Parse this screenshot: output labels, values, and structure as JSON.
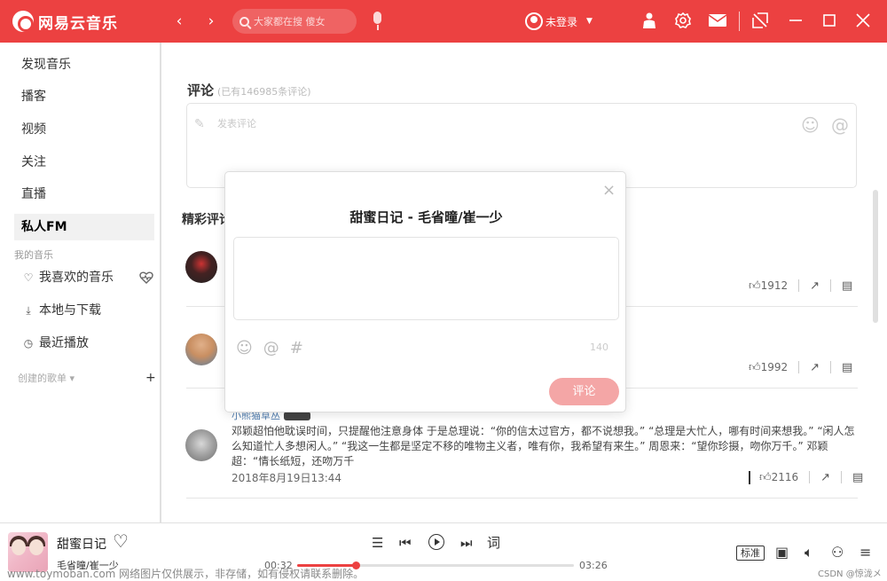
{
  "app": {
    "logo_text": "网易云音乐"
  },
  "header": {
    "back_glyph": "‹",
    "forward_glyph": "›",
    "search_placeholder": "大家都在搜 傻女",
    "user_label": "未登录",
    "icons": [
      "back-icon",
      "forward-icon",
      "search-icon",
      "mic-icon",
      "avatar",
      "clothes-icon",
      "gear-icon",
      "mail-icon",
      "mini-mode-icon",
      "minimize-icon",
      "maximize-icon",
      "close-icon"
    ]
  },
  "sidebar": {
    "items": [
      {
        "label": "发现音乐"
      },
      {
        "label": "播客"
      },
      {
        "label": "视频"
      },
      {
        "label": "关注"
      },
      {
        "label": "直播"
      },
      {
        "label": "私人FM"
      }
    ],
    "my_music_title": "我的音乐",
    "my_music": [
      {
        "label": "我喜欢的音乐",
        "icon": "heart-icon"
      },
      {
        "label": "本地与下载",
        "icon": "download-icon"
      },
      {
        "label": "最近播放",
        "icon": "clock-icon"
      }
    ],
    "created_playlists": "创建的歌单",
    "add_glyph": "+"
  },
  "comments": {
    "title": "评论",
    "count_text": "(已有146985条评论)",
    "input_placeholder": "发表评论",
    "hot_title": "精彩评论",
    "list": [
      {
        "likes": "1912"
      },
      {
        "likes": "1992"
      },
      {
        "user": "小熊猫草丛",
        "text": "邓颖超怕他耽误时间，只提醒他注意身体 于是总理说：“你的信太过官方，都不说想我。” “总理是大忙人，哪有时间来想我。” “闲人怎么知道忙人多想闲人。” “我这一生都是坚定不移的唯物主义者，唯有你，我希望有来生。” 周恩来：“望你珍摄，吻你万千。” 邓颖超：“情长纸短，还吻万千",
        "time": "2018年8月19日13:44",
        "likes": "2116"
      }
    ]
  },
  "modal": {
    "title": "甜蜜日记 - 毛省曈/崔一少",
    "char_count": "140",
    "submit_label": "评论",
    "close_glyph": "×"
  },
  "player": {
    "song": "甜蜜日记",
    "artist": "毛省曈/崔一少",
    "current_time": "00:32",
    "total_time": "03:26",
    "progress": 0.21,
    "quality": "标准",
    "lyrics_label": "词"
  },
  "watermark": "www.toymoban.com 网络图片仅供展示，非存储，如有侵权请联系删除。",
  "csdn_credit": "CSDN @惊泷メ",
  "colors": {
    "brand": "#ec4141",
    "submit_disabled": "#f4a6a6"
  }
}
